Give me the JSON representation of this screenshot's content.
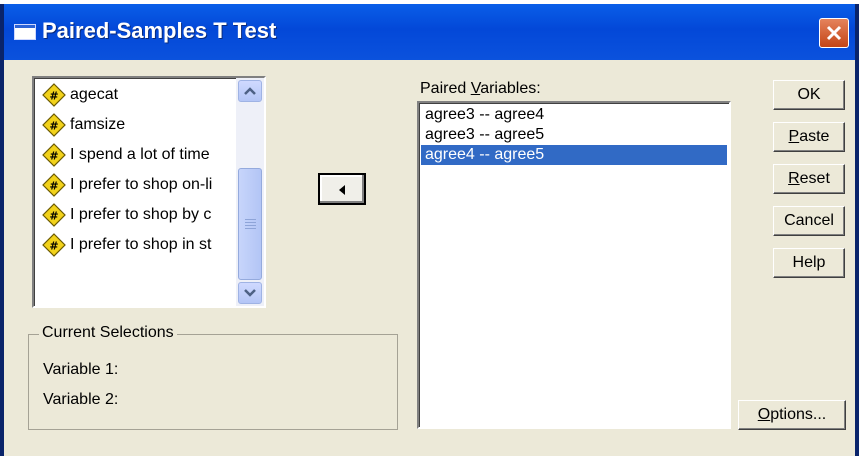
{
  "window": {
    "title": "Paired-Samples T Test",
    "title_icon": "window-icon",
    "close_icon": "close-icon"
  },
  "variables": {
    "items": [
      {
        "label": "agecat",
        "icon": "numeric-variable-icon"
      },
      {
        "label": "famsize",
        "icon": "numeric-variable-icon"
      },
      {
        "label": "I spend a lot of time",
        "icon": "numeric-variable-icon"
      },
      {
        "label": "I prefer to shop on-li",
        "icon": "numeric-variable-icon"
      },
      {
        "label": "I prefer to shop by c",
        "icon": "numeric-variable-icon"
      },
      {
        "label": "I prefer to shop in st",
        "icon": "numeric-variable-icon"
      }
    ]
  },
  "move_button": {
    "icon": "arrow-left-icon"
  },
  "paired": {
    "label_prefix": "Paired ",
    "label_accel": "V",
    "label_suffix": "ariables:",
    "rows": [
      {
        "text": "agree3 -- agree4",
        "selected": false
      },
      {
        "text": "agree3 -- agree5",
        "selected": false
      },
      {
        "text": "agree4 -- agree5",
        "selected": true
      }
    ]
  },
  "current_selections": {
    "legend": "Current Selections",
    "variable1": "Variable 1:",
    "variable2": "Variable 2:"
  },
  "buttons": {
    "ok": "OK",
    "paste_accel": "P",
    "paste_rest": "aste",
    "reset_accel": "R",
    "reset_rest": "eset",
    "cancel": "Cancel",
    "help": "Help",
    "options_accel": "O",
    "options_rest": "ptions..."
  },
  "colors": {
    "titlebar": "#0348d8",
    "selection": "#316ac5",
    "dialog_bg": "#ece9d8"
  }
}
